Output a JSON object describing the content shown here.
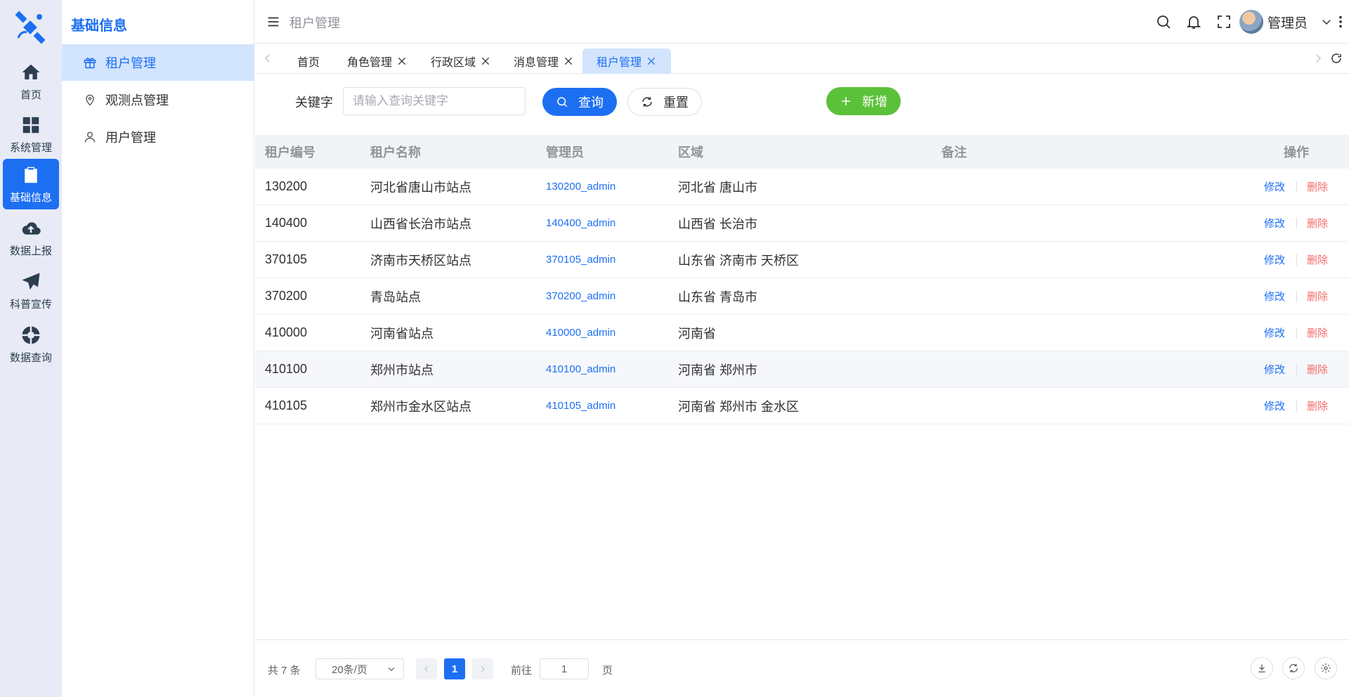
{
  "rail": {
    "items": [
      {
        "label": "首页",
        "icon": "home-icon"
      },
      {
        "label": "系统管理",
        "icon": "grid-icon"
      },
      {
        "label": "基础信息",
        "icon": "clipboard-icon"
      },
      {
        "label": "数据上报",
        "icon": "cloud-upload-icon"
      },
      {
        "label": "科普宣传",
        "icon": "paper-plane-icon"
      },
      {
        "label": "数据查询",
        "icon": "compass-icon"
      }
    ],
    "active_index": 2
  },
  "sidebar": {
    "title": "基础信息",
    "items": [
      {
        "label": "租户管理",
        "icon": "gift-icon"
      },
      {
        "label": "观测点管理",
        "icon": "location-icon"
      },
      {
        "label": "用户管理",
        "icon": "user-icon"
      }
    ]
  },
  "header": {
    "breadcrumb": "租户管理",
    "user_name": "管理员"
  },
  "tabs": [
    {
      "label": "首页",
      "closable": false
    },
    {
      "label": "角色管理",
      "closable": true
    },
    {
      "label": "行政区域",
      "closable": true
    },
    {
      "label": "消息管理",
      "closable": true
    },
    {
      "label": "租户管理",
      "closable": true,
      "active": true
    }
  ],
  "search": {
    "keyword_label": "关键字",
    "keyword_placeholder": "请输入查询关键字",
    "keyword_value": "",
    "query_label": "查询",
    "reset_label": "重置",
    "add_label": "新增"
  },
  "table": {
    "headers": [
      "租户编号",
      "租户名称",
      "管理员",
      "区域",
      "备注",
      "操作"
    ],
    "rows": [
      {
        "code": "130200",
        "name": "河北省唐山市站点",
        "admin": "130200_admin",
        "region": "河北省 唐山市",
        "remark": ""
      },
      {
        "code": "140400",
        "name": "山西省长治市站点",
        "admin": "140400_admin",
        "region": "山西省 长治市",
        "remark": ""
      },
      {
        "code": "370105",
        "name": "济南市天桥区站点",
        "admin": "370105_admin",
        "region": "山东省 济南市 天桥区",
        "remark": ""
      },
      {
        "code": "370200",
        "name": "青岛站点",
        "admin": "370200_admin",
        "region": "山东省 青岛市",
        "remark": ""
      },
      {
        "code": "410000",
        "name": "河南省站点",
        "admin": "410000_admin",
        "region": "河南省",
        "remark": ""
      },
      {
        "code": "410100",
        "name": "郑州市站点",
        "admin": "410100_admin",
        "region": "河南省 郑州市",
        "remark": ""
      },
      {
        "code": "410105",
        "name": "郑州市金水区站点",
        "admin": "410105_admin",
        "region": "河南省 郑州市 金水区",
        "remark": ""
      }
    ],
    "edit_label": "修改",
    "delete_label": "删除",
    "hover_row_index": 5
  },
  "pagination": {
    "total_text": "共 7 条",
    "page_size": "20条/页",
    "current_page": "1",
    "goto_label": "前往",
    "goto_value": "1",
    "page_word": "页"
  },
  "colors": {
    "primary": "#1d6ff2",
    "success": "#5cc13a",
    "danger": "#f56c6c",
    "rail_bg": "#e8ebf5",
    "active_bg": "#d3e4fd"
  }
}
